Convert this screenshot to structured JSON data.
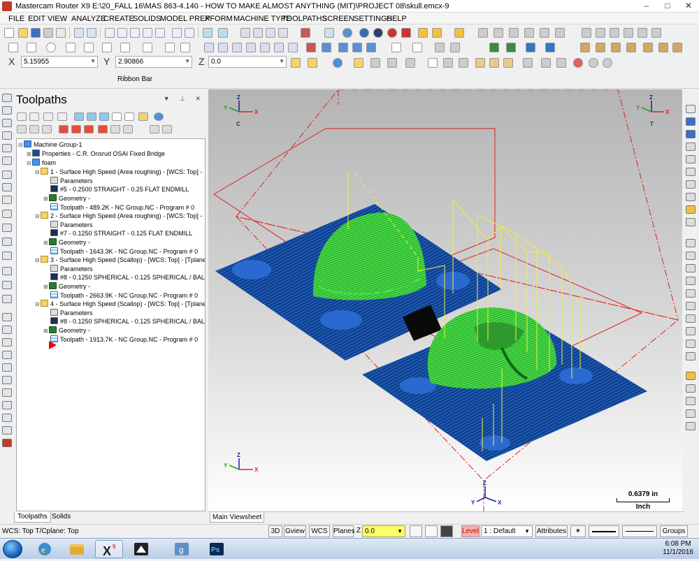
{
  "window": {
    "title": "Mastercam Router X9  E:\\20_FALL 16\\MAS 863-4.140 - HOW TO MAKE ALMOST ANYTHING (MIT)\\PROJECT 08\\skull.emcx-9",
    "controls": {
      "minimize": "–",
      "maximize": "□",
      "close": "✕"
    }
  },
  "menu": [
    "FILE",
    "EDIT",
    "VIEW",
    "ANALYZE",
    "CREATE",
    "SOLIDS",
    "MODEL PREP",
    "XFORM",
    "MACHINE TYPE",
    "TOOLPATHS",
    "SCREEN",
    "SETTINGS",
    "HELP"
  ],
  "coords": {
    "x_label": "X",
    "x_value": "5.15955",
    "y_label": "Y",
    "y_value": "2.90866",
    "z_label": "Z",
    "z_value": "0.0"
  },
  "ribbon_bar_label": "Ribbon Bar",
  "toolpaths_panel": {
    "title": "Toolpaths",
    "tree": [
      {
        "label": "Machine Group-1",
        "icon": "machine-group-icon"
      },
      {
        "label": "Properties - C.R. Onsrud OSAI Fixed Bridge",
        "icon": "properties-icon"
      },
      {
        "label": "foam",
        "icon": "stock-icon"
      },
      {
        "label": "1 - Surface High Speed (Area roughing) - [WCS: Top] -",
        "icon": "operation-folder-icon"
      },
      {
        "label": "Parameters",
        "icon": "parameters-icon"
      },
      {
        "label": "#5 - 0.2500 STRAIGHT - 0.25 FLAT ENDMILL",
        "icon": "tool-icon"
      },
      {
        "label": "Geometry -",
        "icon": "geometry-icon"
      },
      {
        "label": "Toolpath - 489.2K - NC Group.NC - Program # 0",
        "icon": "toolpath-icon"
      },
      {
        "label": "2 - Surface High Speed (Area roughing) - [WCS: Top] -",
        "icon": "operation-folder-icon"
      },
      {
        "label": "Parameters",
        "icon": "parameters-icon"
      },
      {
        "label": "#7 - 0.1250 STRAIGHT - 0.125 FLAT ENDMILL",
        "icon": "tool-icon"
      },
      {
        "label": "Geometry -",
        "icon": "geometry-icon"
      },
      {
        "label": "Toolpath - 1643.3K - NC Group.NC - Program # 0",
        "icon": "toolpath-icon"
      },
      {
        "label": "3 - Surface High Speed (Scallop) - [WCS: Top] - [Tplane",
        "icon": "operation-folder-icon"
      },
      {
        "label": "Parameters",
        "icon": "parameters-icon"
      },
      {
        "label": "#8 - 0.1250 SPHERICAL - 0.125 SPHERICAL / BALL",
        "icon": "tool-icon"
      },
      {
        "label": "Geometry -",
        "icon": "geometry-icon"
      },
      {
        "label": "Toolpath - 2663.9K - NC Group.NC - Program # 0",
        "icon": "toolpath-icon"
      },
      {
        "label": "4 - Surface High Speed (Scallop) - [WCS: Top] - [Tplane",
        "icon": "operation-folder-icon"
      },
      {
        "label": "Parameters",
        "icon": "parameters-icon"
      },
      {
        "label": "#8 - 0.1250 SPHERICAL - 0.125 SPHERICAL / BALL",
        "icon": "tool-icon"
      },
      {
        "label": "Geometry -",
        "icon": "geometry-icon"
      },
      {
        "label": "Toolpath - 1913.7K - NC Group.NC - Program # 0",
        "icon": "toolpath-icon"
      }
    ],
    "tabs": [
      "Toolpaths",
      "Solids"
    ]
  },
  "viewport": {
    "tab": "Main Viewsheet",
    "scale_value": "0.6379 in",
    "scale_unit": "Inch",
    "axis_labels": {
      "x": "X",
      "y": "Y",
      "z": "Z",
      "c": "C",
      "t": "T"
    },
    "colors": {
      "boundary": "#e02020",
      "toolpath": "#f2ef3a",
      "fixture": "#123f8a",
      "model": "#2fd12f"
    }
  },
  "status": {
    "wcs_text": "WCS: Top  T/Cplane: Top",
    "btn_3d": "3D",
    "btn_gview": "Gview",
    "btn_wcs": "WCS",
    "btn_planes": "Planes",
    "z_label": "Z",
    "z_value": "0.0",
    "level_label": "Level",
    "level_value": "1 : Default",
    "attributes": "Attributes",
    "groups": "Groups"
  },
  "taskbar": {
    "time": "6:08 PM",
    "date": "11/1/2016"
  }
}
